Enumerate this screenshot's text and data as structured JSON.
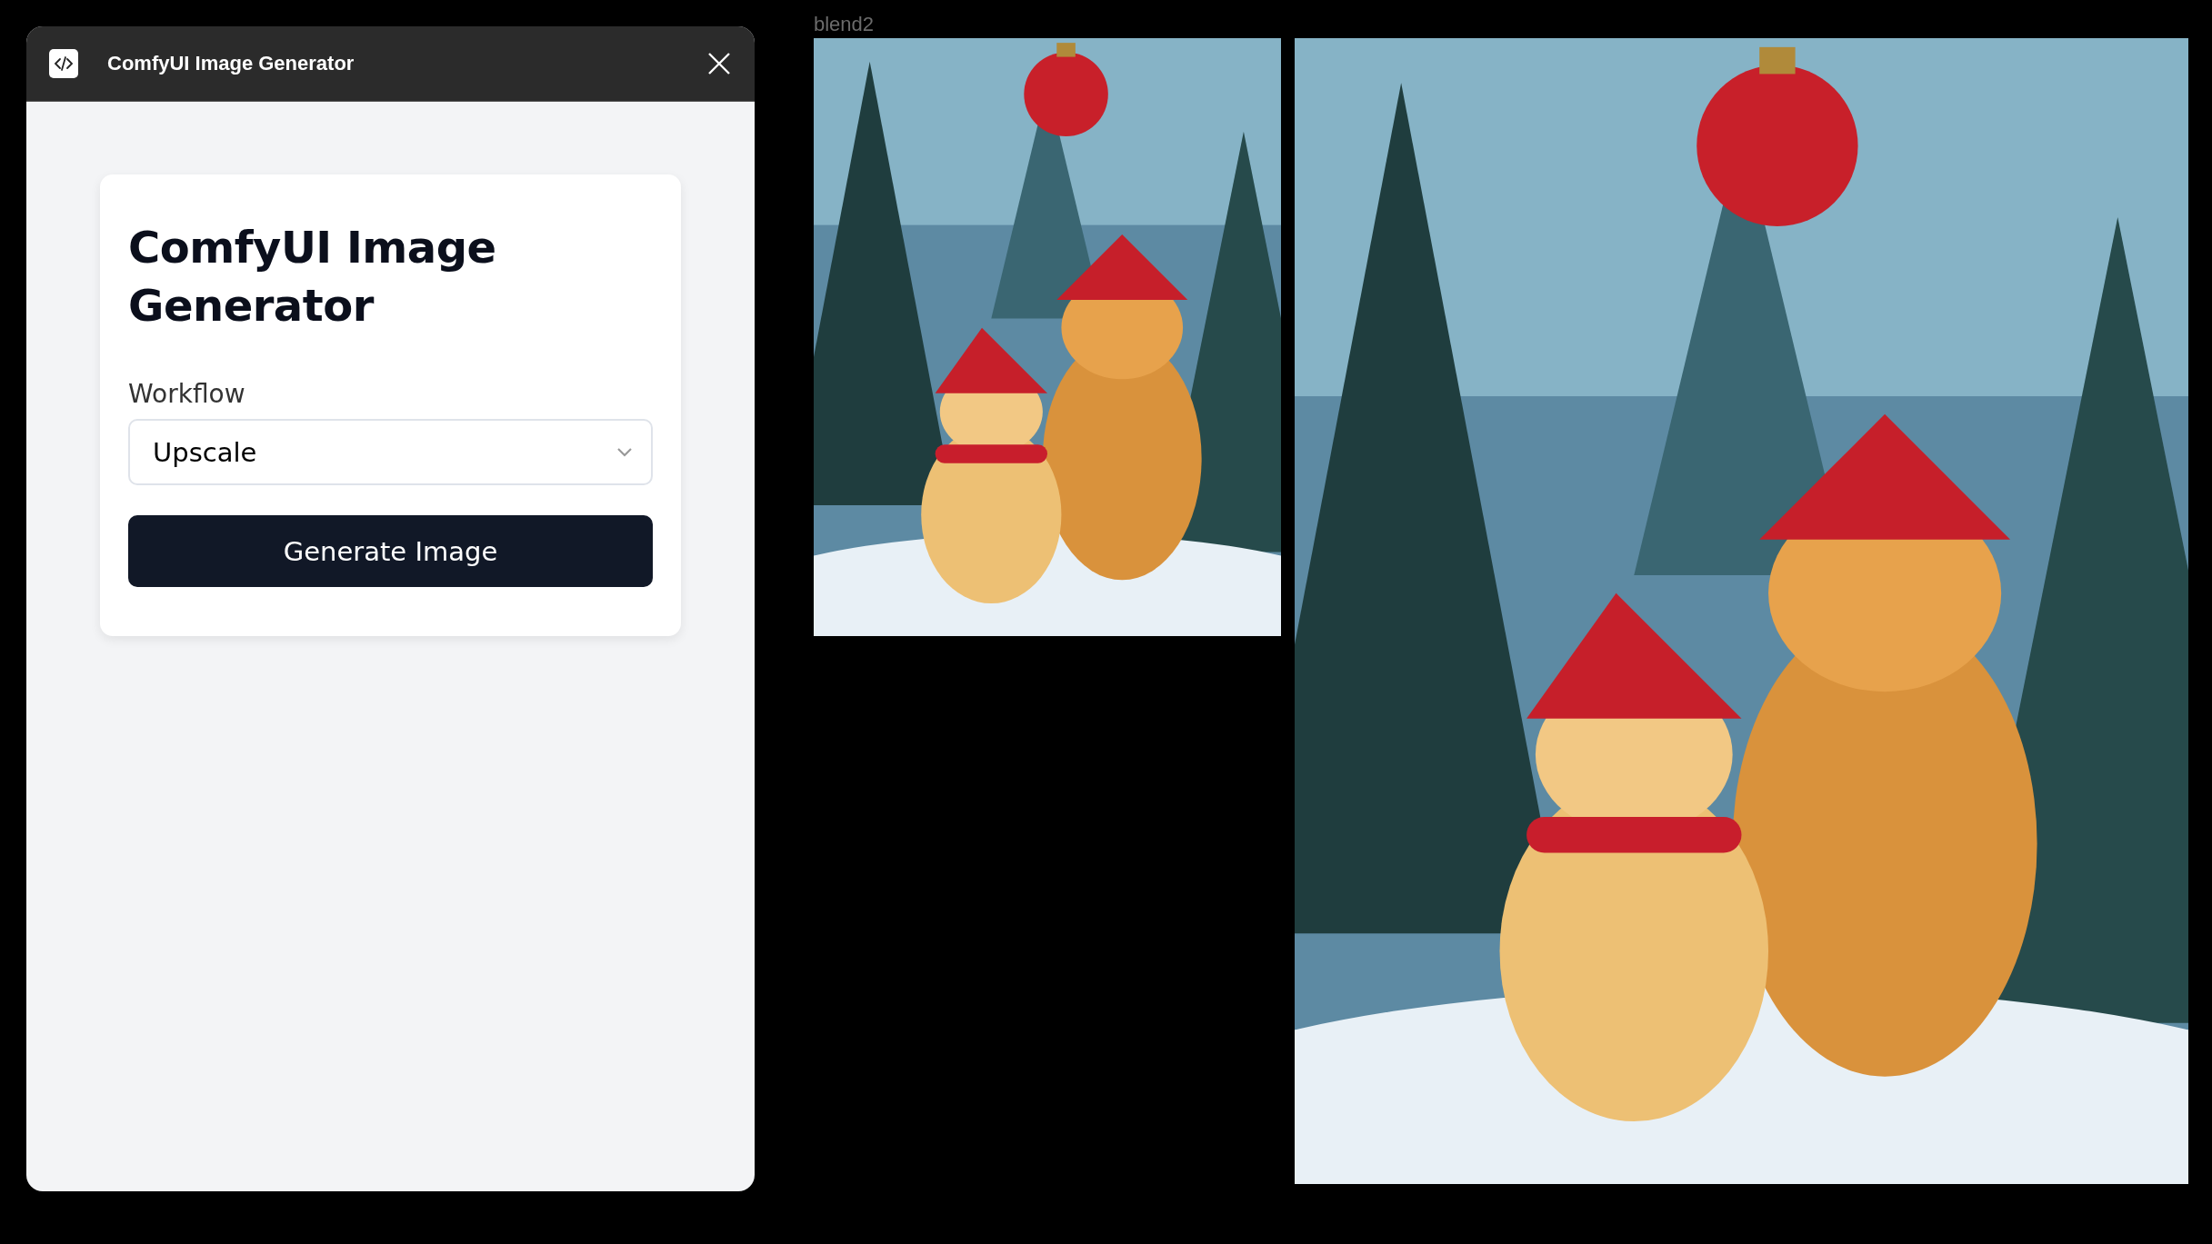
{
  "window": {
    "title": "ComfyUI Image Generator"
  },
  "form": {
    "heading": "ComfyUI Image Generator",
    "workflow_label": "Workflow",
    "workflow": {
      "value": "Upscale"
    },
    "button": "Generate Image"
  },
  "gallery": {
    "label": "blend2"
  }
}
